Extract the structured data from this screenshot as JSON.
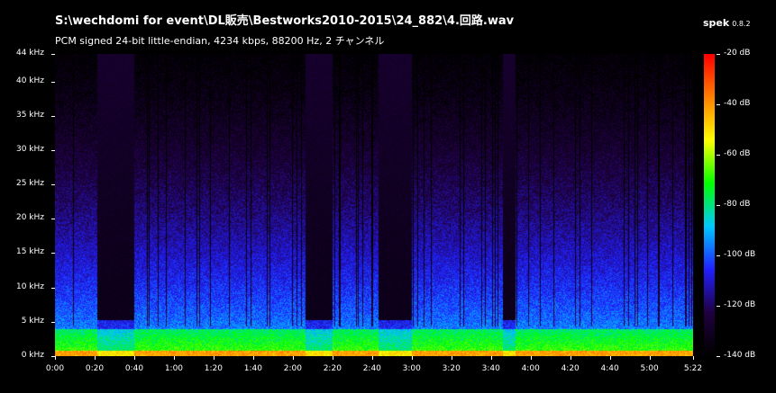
{
  "window": {
    "title": "S:\\wechdomi for event\\DL販売\\Bestworks2010-2015\\24_882\\4.回路.wav",
    "info": "PCM signed 24-bit little-endian, 4234 kbps, 88200 Hz, 2 チャンネル",
    "app_name": "spek",
    "app_version": "0.8.2"
  },
  "spectrogram": {
    "freq_axis": {
      "unit": "kHz",
      "range_khz": [
        0,
        44
      ],
      "labels": [
        "0 kHz",
        "5 kHz",
        "10 kHz",
        "15 kHz",
        "20 kHz",
        "25 kHz",
        "30 kHz",
        "35 kHz",
        "40 kHz",
        "44 kHz"
      ],
      "values": [
        0,
        5,
        10,
        15,
        20,
        25,
        30,
        35,
        40,
        44
      ]
    },
    "time_axis": {
      "range_seconds": [
        0,
        322
      ],
      "labels": [
        "0:00",
        "0:20",
        "0:40",
        "1:00",
        "1:20",
        "1:40",
        "2:00",
        "2:20",
        "2:40",
        "3:00",
        "3:20",
        "3:40",
        "4:00",
        "4:20",
        "4:40",
        "5:00",
        "5:22"
      ],
      "values": [
        0,
        20,
        40,
        60,
        80,
        100,
        120,
        140,
        160,
        180,
        200,
        220,
        240,
        260,
        280,
        300,
        322
      ]
    },
    "level_scale": {
      "unit": "dB",
      "range_db": [
        -140,
        -20
      ],
      "labels": [
        "-20 dB",
        "-40 dB",
        "-60 dB",
        "-80 dB",
        "-100 dB",
        "-120 dB",
        "-140 dB"
      ],
      "values": [
        -20,
        -40,
        -60,
        -80,
        -100,
        -120,
        -140
      ],
      "colors": [
        "#ff0000",
        "#ff8000",
        "#ffff00",
        "#00ff00",
        "#00c8ff",
        "#2020ff",
        "#200040",
        "#000000"
      ]
    },
    "quiet_regions_seconds": [
      [
        21,
        40
      ],
      [
        126,
        140
      ],
      [
        163,
        180
      ],
      [
        226,
        232
      ]
    ]
  }
}
